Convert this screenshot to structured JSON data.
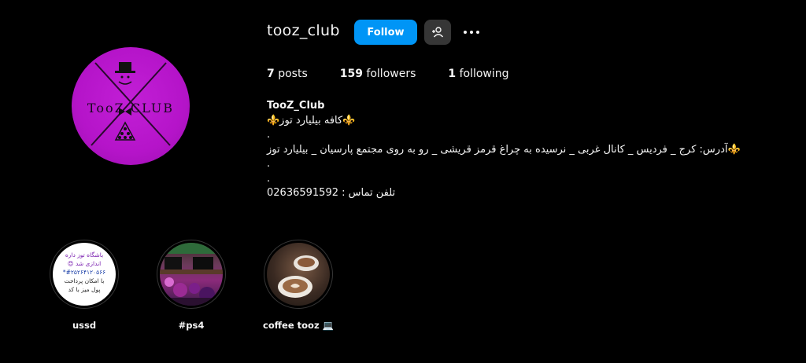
{
  "profile": {
    "username": "tooz_club",
    "follow_label": "Follow",
    "avatar_text": "TooZ CLUB",
    "stats": {
      "posts_count": "7",
      "posts_label": "posts",
      "followers_count": "159",
      "followers_label": "followers",
      "following_count": "1",
      "following_label": "following"
    },
    "bio": {
      "name": "TooZ_Club",
      "line1": "⚜️کافه بیلیارد توز⚜️",
      "line2": ".",
      "line3": "⚜️آدرس: کرج _ فردیس _ کانال غربی _ نرسیده به چراغ قرمز قریشی _ رو به روی مجتمع پارسیان _ بیلیارد توز",
      "line4": ".",
      "line5": ".",
      "line6": "تلفن تماس : 02636591592"
    }
  },
  "highlights": [
    {
      "label": "ussd",
      "cover_lines": [
        "باشگاه توز داره",
        "اندازی شد 😍",
        "#۲۵۲۶۴۱۲۰۵۶۶*",
        "با امکان پرداخت",
        "پول میز با کد"
      ]
    },
    {
      "label": "#ps4"
    },
    {
      "label": "coffee tooz 💻"
    }
  ],
  "colors": {
    "background": "#000000",
    "follow_button": "#0095f6",
    "secondary_button": "#363636",
    "avatar": "#b514c9"
  }
}
